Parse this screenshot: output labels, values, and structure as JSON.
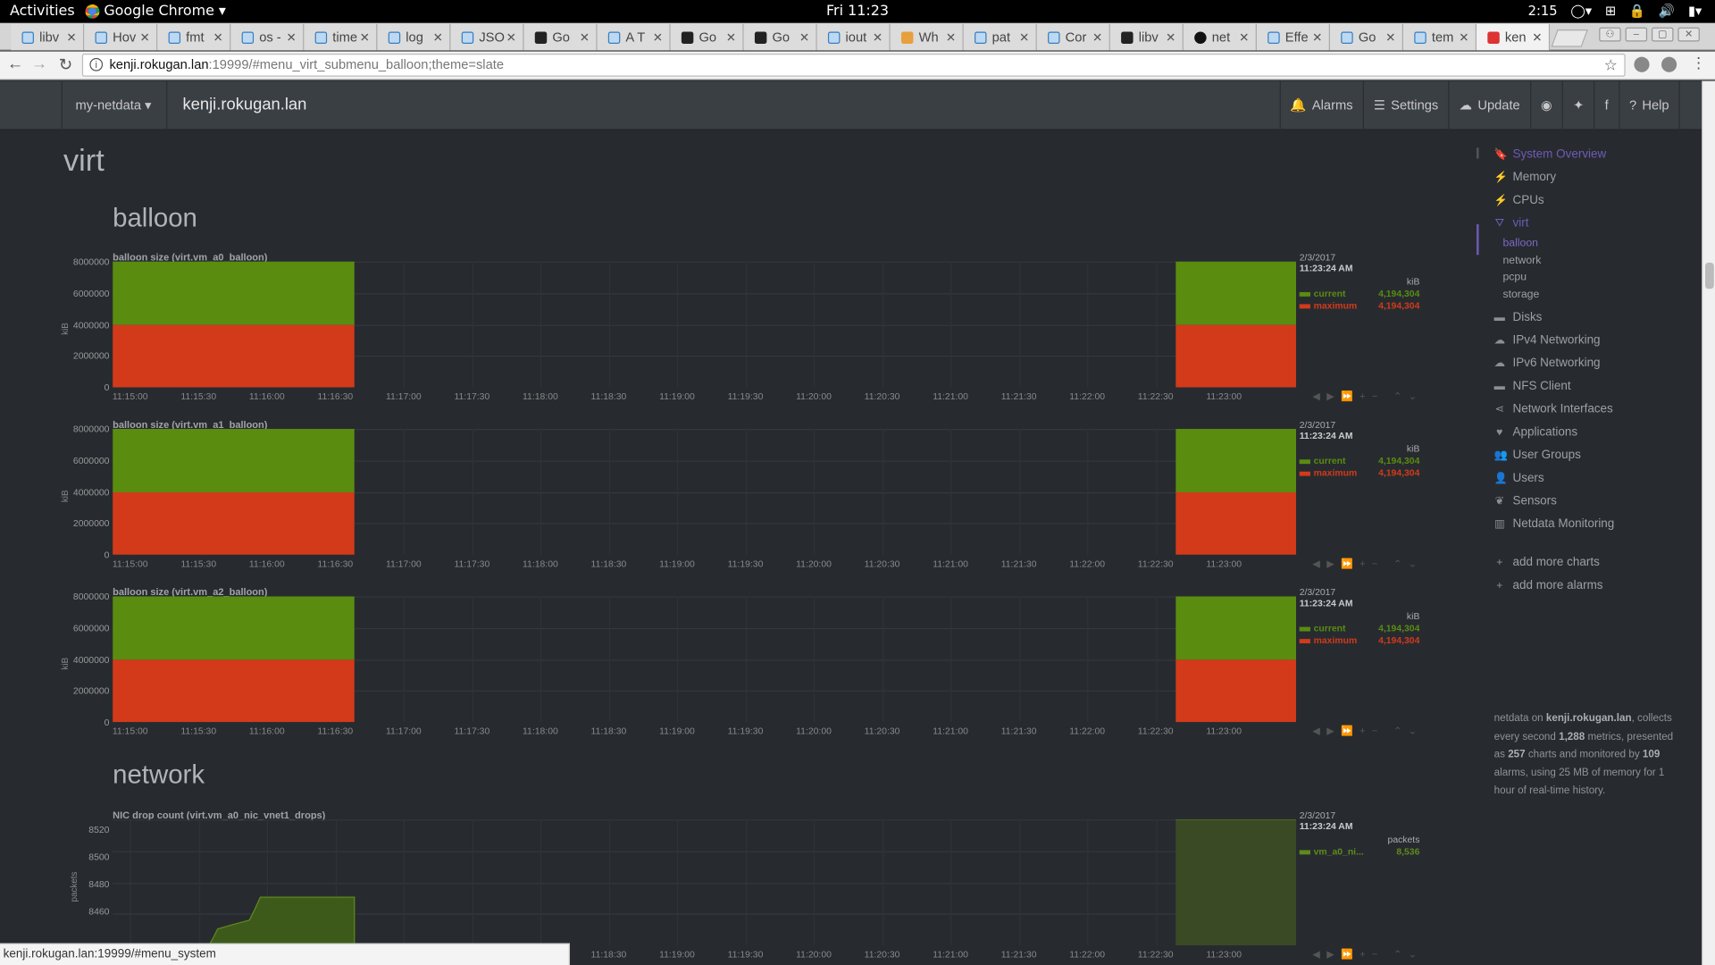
{
  "gnome": {
    "activities": "Activities",
    "app": "Google Chrome",
    "clock": "Fri 11:23",
    "battery": "2:15"
  },
  "tabs": [
    {
      "title": "libv",
      "icon": "google-doc-icon",
      "cls": ""
    },
    {
      "title": "Hov",
      "icon": "confluence-icon",
      "cls": ""
    },
    {
      "title": "fmt",
      "icon": "confluence-icon",
      "cls": ""
    },
    {
      "title": "os -",
      "icon": "confluence-icon",
      "cls": ""
    },
    {
      "title": "time",
      "icon": "confluence-icon",
      "cls": ""
    },
    {
      "title": "log",
      "icon": "confluence-icon",
      "cls": ""
    },
    {
      "title": "JSO",
      "icon": "confluence-icon",
      "cls": ""
    },
    {
      "title": "Go",
      "icon": "godoc-icon",
      "cls": "dark"
    },
    {
      "title": "A T",
      "icon": "confluence-icon",
      "cls": ""
    },
    {
      "title": "Go",
      "icon": "godoc-icon",
      "cls": "dark"
    },
    {
      "title": "Go",
      "icon": "godoc-icon",
      "cls": "dark"
    },
    {
      "title": "iout",
      "icon": "confluence-icon",
      "cls": ""
    },
    {
      "title": "Wh",
      "icon": "stackoverflow-icon",
      "cls": "or"
    },
    {
      "title": "pat",
      "icon": "confluence-icon",
      "cls": ""
    },
    {
      "title": "Cor",
      "icon": "confluence-icon",
      "cls": ""
    },
    {
      "title": "libv",
      "icon": "libvirt-icon",
      "cls": "dark"
    },
    {
      "title": "net",
      "icon": "github-icon",
      "cls": "gh"
    },
    {
      "title": "Effe",
      "icon": "confluence-icon",
      "cls": ""
    },
    {
      "title": "Go",
      "icon": "confluence-icon",
      "cls": ""
    },
    {
      "title": "tem",
      "icon": "confluence-icon",
      "cls": ""
    },
    {
      "title": "ken",
      "icon": "netdata-icon",
      "cls": "red"
    }
  ],
  "address": {
    "host": "kenji.rokugan.lan",
    "path": ":19999/#menu_virt_submenu_balloon;theme=slate"
  },
  "navbar": {
    "brand": "my-netdata",
    "host": "kenji.rokugan.lan",
    "alarms": "Alarms",
    "settings": "Settings",
    "update": "Update",
    "help": "Help"
  },
  "page": {
    "section": "virt",
    "balloon": "balloon",
    "network": "network"
  },
  "colors": {
    "current": "#5a8c10",
    "maximum": "#d33a1a",
    "drops": "#5f8a1b"
  },
  "xticks": [
    "11:15:00",
    "11:15:30",
    "11:16:00",
    "11:16:30",
    "11:17:00",
    "11:17:30",
    "11:18:00",
    "11:18:30",
    "11:19:00",
    "11:19:30",
    "11:20:00",
    "11:20:30",
    "11:21:00",
    "11:21:30",
    "11:22:00",
    "11:22:30",
    "11:23:00"
  ],
  "charts": [
    {
      "title": "balloon size (virt.vm_a0_balloon)",
      "unit": "kiB",
      "yticks": [
        "8000000",
        "6000000",
        "4000000",
        "2000000",
        "0"
      ],
      "date": "2/3/2017",
      "time": "11:23:24 AM",
      "legend": [
        {
          "name": "current",
          "value": "4,194,304"
        },
        {
          "name": "maximum",
          "value": "4,194,304"
        }
      ]
    },
    {
      "title": "balloon size (virt.vm_a1_balloon)",
      "unit": "kiB",
      "yticks": [
        "8000000",
        "6000000",
        "4000000",
        "2000000",
        "0"
      ],
      "date": "2/3/2017",
      "time": "11:23:24 AM",
      "legend": [
        {
          "name": "current",
          "value": "4,194,304"
        },
        {
          "name": "maximum",
          "value": "4,194,304"
        }
      ]
    },
    {
      "title": "balloon size (virt.vm_a2_balloon)",
      "unit": "kiB",
      "yticks": [
        "8000000",
        "6000000",
        "4000000",
        "2000000",
        "0"
      ],
      "date": "2/3/2017",
      "time": "11:23:24 AM",
      "legend": [
        {
          "name": "current",
          "value": "4,194,304"
        },
        {
          "name": "maximum",
          "value": "4,194,304"
        }
      ]
    },
    {
      "title": "NIC drop count (virt.vm_a0_nic_vnet1_drops)",
      "unit": "packets",
      "yticks": [
        "8520",
        "8500",
        "8480",
        "8460"
      ],
      "date": "2/3/2017",
      "time": "11:23:24 AM",
      "legend": [
        {
          "name": "vm_a0_ni...",
          "value": "8,536"
        }
      ]
    }
  ],
  "sidebar": {
    "items": [
      {
        "label": "System Overview",
        "icon": "bookmark-icon",
        "glyph": "🔖"
      },
      {
        "label": "Memory",
        "icon": "bolt-icon",
        "glyph": "⚡"
      },
      {
        "label": "CPUs",
        "icon": "bolt-icon",
        "glyph": "⚡"
      },
      {
        "label": "virt",
        "icon": "sitemap-icon",
        "glyph": "⛛"
      },
      {
        "label": "Disks",
        "icon": "folder-icon",
        "glyph": "▬"
      },
      {
        "label": "IPv4 Networking",
        "icon": "cloud-icon",
        "glyph": "☁"
      },
      {
        "label": "IPv6 Networking",
        "icon": "cloud-icon",
        "glyph": "☁"
      },
      {
        "label": "NFS Client",
        "icon": "folder-icon",
        "glyph": "▬"
      },
      {
        "label": "Network Interfaces",
        "icon": "share-icon",
        "glyph": "⋖"
      },
      {
        "label": "Applications",
        "icon": "heartbeat-icon",
        "glyph": "♥"
      },
      {
        "label": "User Groups",
        "icon": "users-icon",
        "glyph": "👥"
      },
      {
        "label": "Users",
        "icon": "user-icon",
        "glyph": "👤"
      },
      {
        "label": "Sensors",
        "icon": "leaf-icon",
        "glyph": "❦"
      },
      {
        "label": "Netdata Monitoring",
        "icon": "bar-chart-icon",
        "glyph": "▥"
      },
      {
        "label": "add more charts",
        "icon": "plus-icon",
        "glyph": "+"
      },
      {
        "label": "add more alarms",
        "icon": "plus-icon",
        "glyph": "+"
      }
    ],
    "submenu": [
      "balloon",
      "network",
      "pcpu",
      "storage"
    ],
    "info": {
      "pre": "netdata on ",
      "host": "kenji.rokugan.lan",
      "t1": ", collects every second ",
      "metrics": "1,288",
      "t2": " metrics, presented as ",
      "charts": "257",
      "t3": " charts and monitored by ",
      "alarms": "109",
      "t4": " alarms, using 25 MB of memory for 1 hour of real-time history."
    }
  },
  "status": "kenji.rokugan.lan:19999/#menu_system"
}
